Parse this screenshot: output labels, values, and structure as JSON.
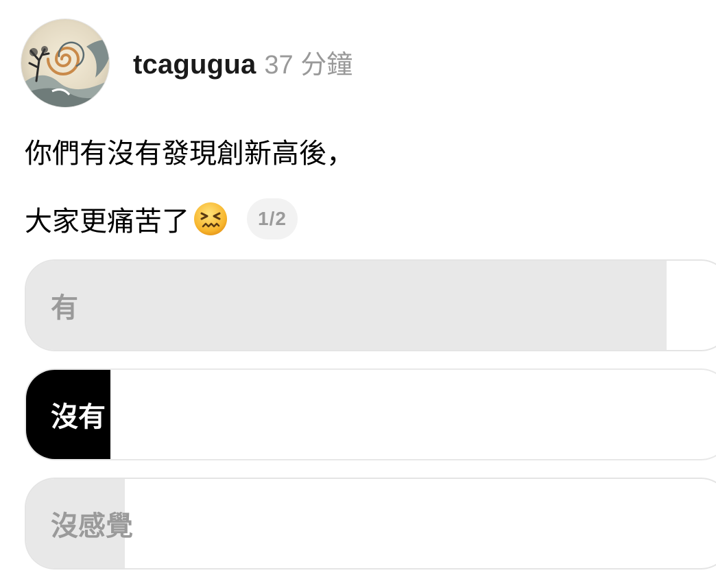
{
  "author": {
    "username": "tcagugua",
    "timestamp": "37 分鐘",
    "avatar_description": "swirl-landscape-avatar"
  },
  "post": {
    "line1": "你們有沒有發現創新高後，",
    "line2": "大家更痛苦了",
    "emoji": "confounded-face-emoji",
    "page_indicator": "1/2"
  },
  "poll": {
    "options": [
      {
        "label": "有",
        "share": 0.91
      },
      {
        "label": "沒有",
        "share": 0.12
      },
      {
        "label": "沒感覺",
        "share": 0.14
      }
    ]
  },
  "colors": {
    "text": "#000000",
    "muted": "#999999",
    "bar_fill": "#e8e8e8",
    "selected_fill": "#000000",
    "pill_bg": "#f2f2f2"
  }
}
